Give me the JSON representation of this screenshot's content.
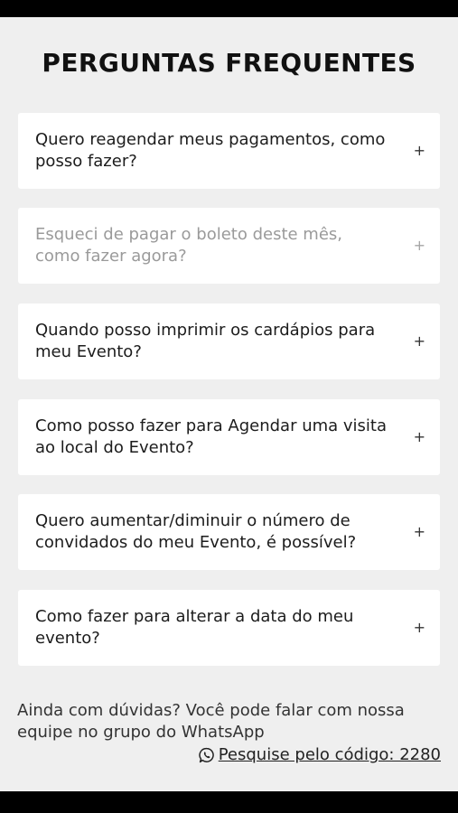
{
  "title": "PERGUNTAS FREQUENTES",
  "faq": [
    {
      "question": "Quero reagendar meus pagamentos, como posso fazer?",
      "toggle": "+"
    },
    {
      "question": "Esqueci de pagar o boleto deste mês, como fazer agora?",
      "toggle": "+"
    },
    {
      "question": "Quando posso imprimir os cardápios para meu Evento?",
      "toggle": "+"
    },
    {
      "question": "Como posso fazer para Agendar uma visita ao local do Evento?",
      "toggle": "+"
    },
    {
      "question": "Quero aumentar/diminuir o número de convidados do meu Evento, é possível?",
      "toggle": "+"
    },
    {
      "question": "Como fazer para alterar a data do meu evento?",
      "toggle": "+"
    }
  ],
  "footer": {
    "text": "Ainda com dúvidas? Você pode falar com nossa equipe no grupo do WhatsApp",
    "link_label": "Pesquise pelo código: 2280",
    "link_icon": "whatsapp-icon"
  }
}
